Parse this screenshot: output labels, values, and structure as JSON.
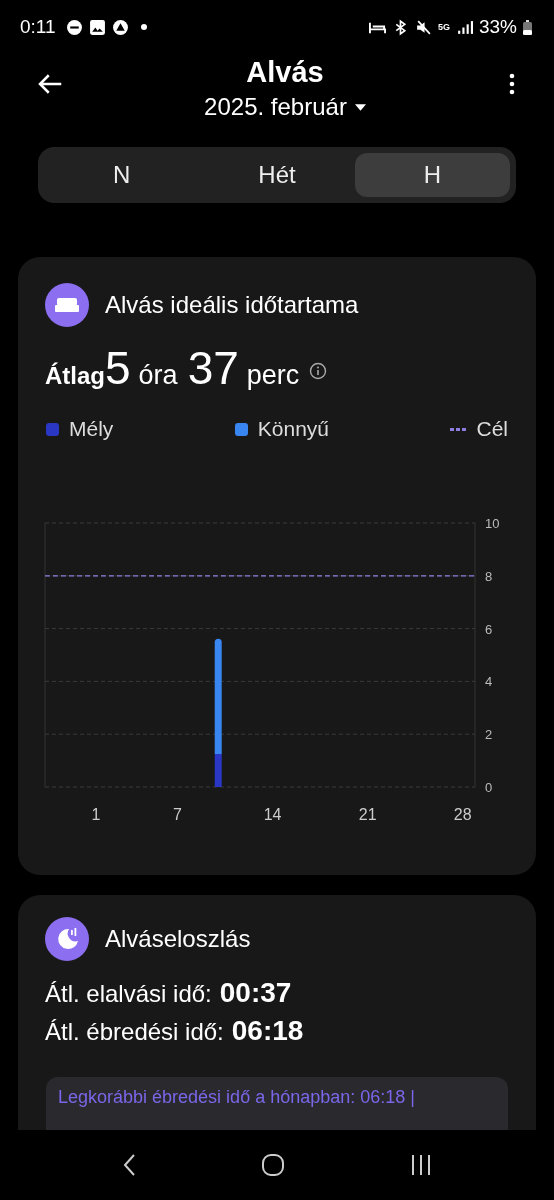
{
  "status_bar": {
    "time": "0:11",
    "network": "5G",
    "battery": "33%"
  },
  "header": {
    "title": "Alvás",
    "period": "2025. február"
  },
  "tabs": [
    {
      "label": "N",
      "selected": false
    },
    {
      "label": "Hét",
      "selected": false
    },
    {
      "label": "H",
      "selected": true
    }
  ],
  "duration_card": {
    "title": "Alvás ideális időtartama",
    "average": {
      "label": "Átlag",
      "hours": "5",
      "hours_unit": "óra",
      "minutes": "37",
      "minutes_unit": "perc"
    },
    "chart_data": {
      "type": "bar",
      "stacked": true,
      "grid": true,
      "x": [
        10
      ],
      "series": [
        {
          "name": "Mély",
          "color": "#2a36c4",
          "values": [
            1.25
          ]
        },
        {
          "name": "Könnyű",
          "color": "#3a86f0",
          "values": [
            4.37
          ]
        }
      ],
      "xlim": [
        -2.75,
        28.9
      ],
      "ylim": [
        0,
        10
      ],
      "xticks": [
        1,
        7,
        14,
        21,
        28
      ],
      "yticks": [
        0,
        2,
        4,
        6,
        8,
        10
      ],
      "ref_lines": [
        {
          "axis": "y",
          "value": 8,
          "label": "Cél",
          "color": "#8c7ee0"
        }
      ]
    }
  },
  "distribution_card": {
    "title": "Alváseloszlás",
    "stats": [
      {
        "label": "Átl. elalvási idő:",
        "value": "00:37"
      },
      {
        "label": "Átl. ébredési idő:",
        "value": "06:18"
      }
    ],
    "note": "Legkorábbi ébredési idő a hónapban: 06:18 |"
  }
}
